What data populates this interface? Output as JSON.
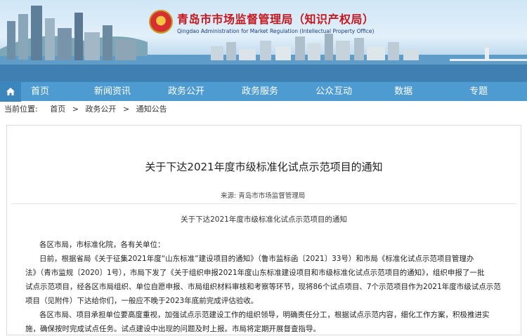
{
  "header": {
    "title_cn": "青岛市市场监督管理局（知识产权局）",
    "title_en": "Qingdao Administration for Market Regulation (Intellectual Property Office)"
  },
  "nav": {
    "items": [
      "首页",
      "新闻资讯",
      "政务公开",
      "政务服务",
      "公众互动",
      "数据",
      "专题"
    ]
  },
  "breadcrumb": {
    "label": "当前位置:",
    "items": [
      "首页",
      ">",
      "政务公开",
      ">",
      "通知公告"
    ]
  },
  "article": {
    "title": "关于下达2021年度市级标准化试点示范项目的通知",
    "source_label": "来源:",
    "source": "青岛市市场监督管理局",
    "subtitle": "关于下达2021年度市级标准化试点示范项目的通知",
    "lines": [
      "各区市局，市标准化院，各有关单位：",
      "日前，根据省局《关于征集2021年度“山东标准”建设项目的通知》（鲁市监标函〔2021〕33号）和市局《标准化试点示范项目管理办",
      "法》（青市监规〔2020〕1号），市局下发了《关于组织申报2021年度山东标准建设项目和市级标准化试点示范项目的通知》，组织申报了一批",
      "试点示范项目，经各区市局组织、单位自愿申报、市局组织材料审核和考察等环节，现将86个试点项目、7个示范项目作为2021年度市级试点示范",
      "项目（见附件）下达给你们，一般应不晚于2023年底前完成评估验收。",
      "各区市局、项目承担单位要高度重视，加强试点示范建设工作的组织领导，明确责任分工，根据试点示范内容，细化工作方案，积极推进实",
      "施，确保按时完成试点任务。试点建设中出现的问题及时上报。市局将定期开展督查指导。"
    ]
  }
}
